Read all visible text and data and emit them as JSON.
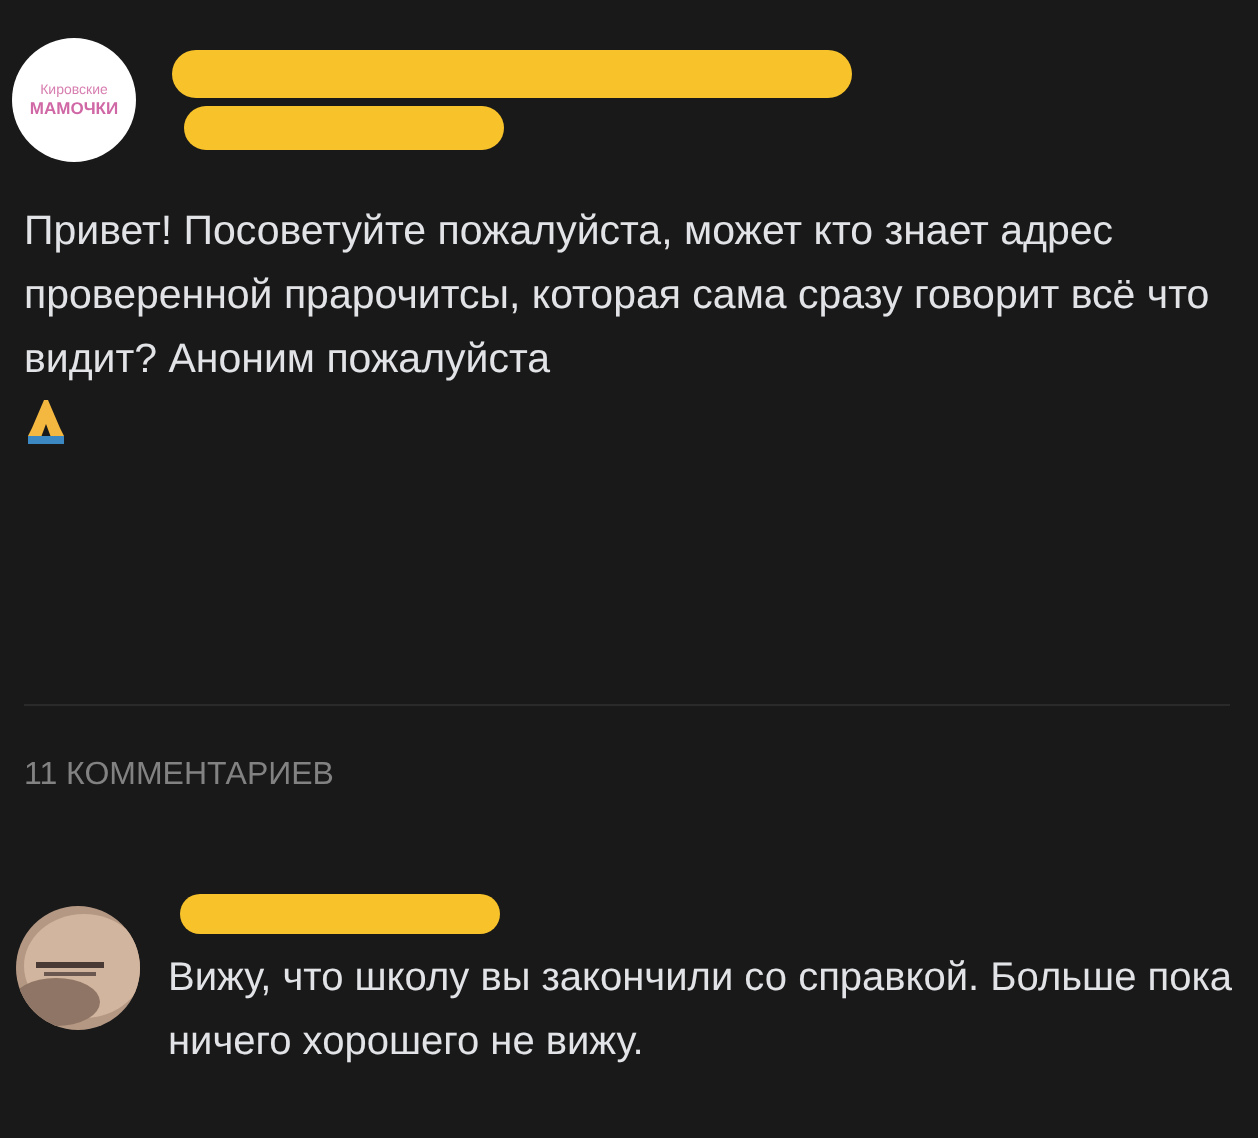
{
  "post": {
    "author_avatar": {
      "line_1": "Кировские",
      "line_2": "МАМОЧКИ"
    },
    "text": "Привет! Посоветуйте пожалуйста, может кто знает адрес проверенной прарочитсы, которая сама сразу говорит всё что видит? Аноним пожалуйста"
  },
  "comments_header": "11 КОММЕНТАРИЕВ",
  "comments": [
    {
      "text": "Вижу, что школу вы закончили со справкой. Больше пока ничего хорошего не вижу."
    }
  ]
}
